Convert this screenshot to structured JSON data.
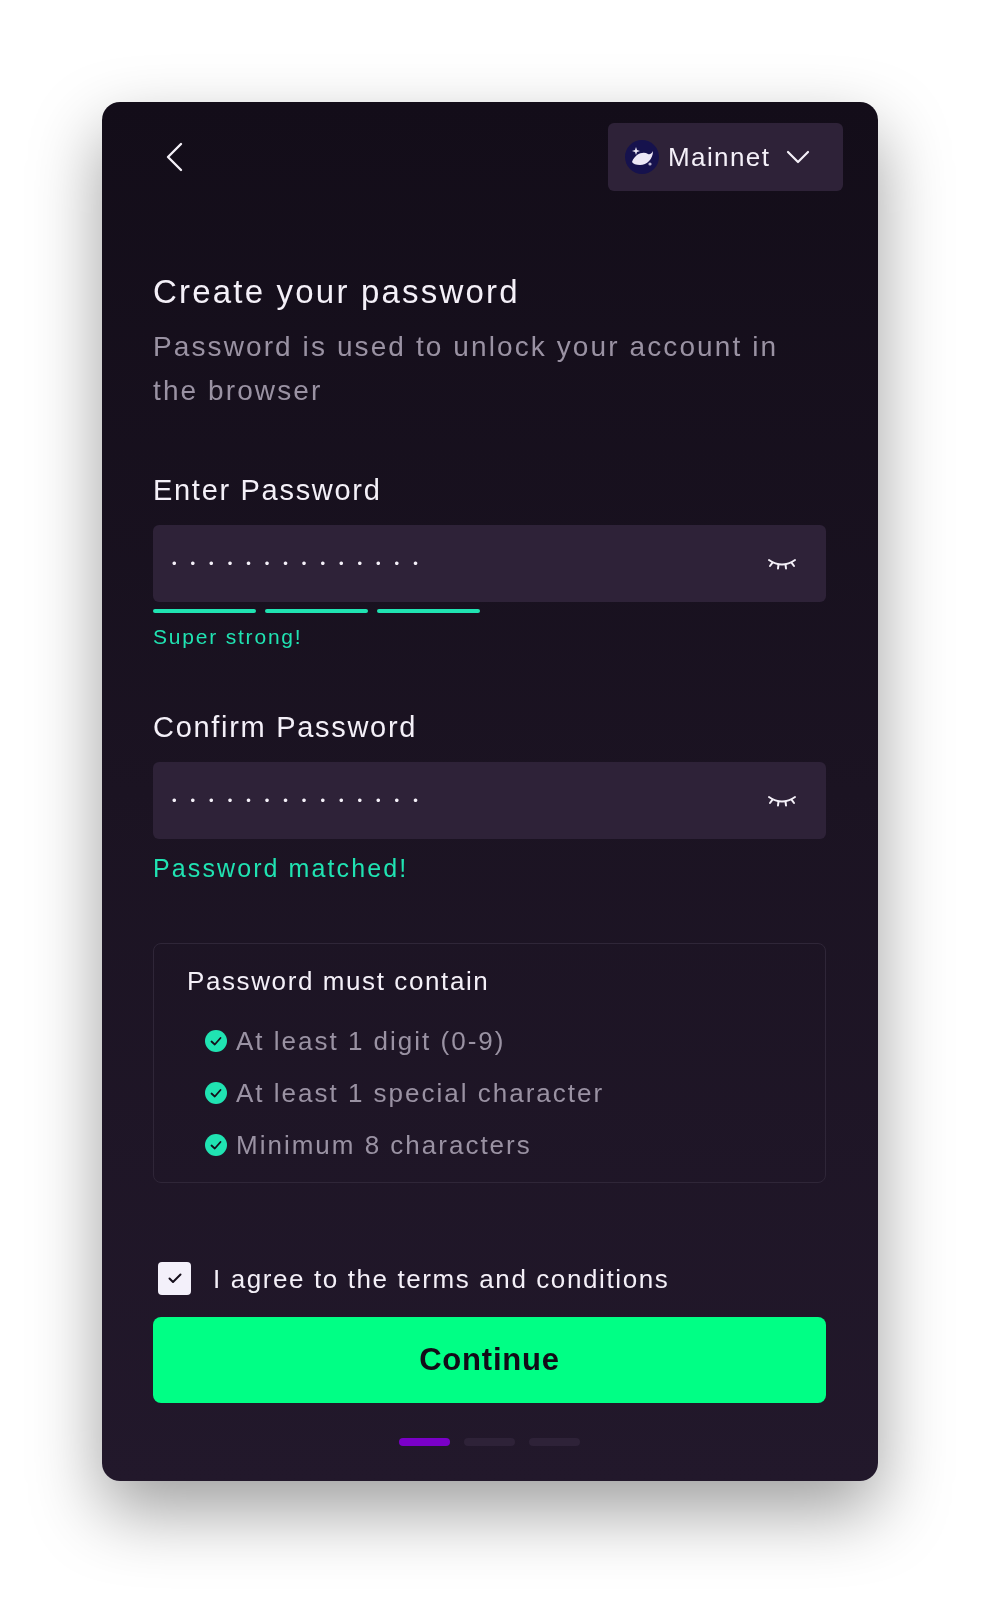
{
  "header": {
    "network": {
      "name": "Mainnet"
    }
  },
  "title": "Create your password",
  "subtitle": "Password is used to unlock your account in the browser",
  "password_fields": [
    {
      "label": "Enter Password",
      "value": "••••••••••••••",
      "strength": {
        "segments": [
          {
            "on": true
          },
          {
            "on": true
          },
          {
            "on": true
          }
        ],
        "label": "Super strong!"
      }
    },
    {
      "label": "Confirm Password",
      "value": "••••••••••••••",
      "status": "Password matched!"
    }
  ],
  "requirements": {
    "title": "Password must contain",
    "items": [
      {
        "text": "At least 1 digit (0-9)",
        "checked": true
      },
      {
        "text": "At least 1 special character",
        "checked": true
      },
      {
        "text": "Minimum 8 characters",
        "checked": true
      }
    ]
  },
  "terms": {
    "label": "I agree to the terms and conditions",
    "checked": true
  },
  "continue_button": {
    "label": "Continue"
  },
  "steps": [
    {
      "selected": true
    },
    {
      "selected": false
    },
    {
      "selected": false
    }
  ]
}
